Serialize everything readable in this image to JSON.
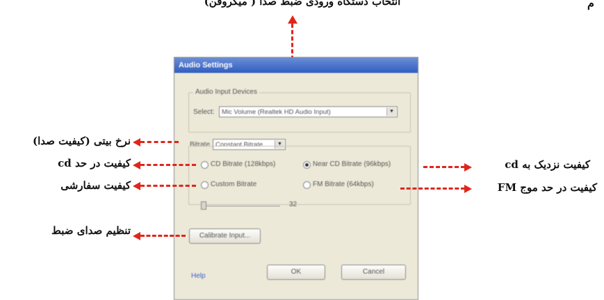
{
  "page": {
    "top_caption": "انتخاب دستگاه ورودی ضبط صدا ( میکروفن)",
    "top_letter": "م"
  },
  "annotations": {
    "bitrate_left": "نرخ بیتی (کیفیت صدا)",
    "cd_quality_left": "کیفیت در حد cd",
    "custom_quality_left": "کیفیت سفارشی",
    "calibrate_left": "تنظیم صدای ضبط",
    "near_cd_right": "کیفیت نزدیک به cd",
    "fm_right": "کیفیت در حد موج FM"
  },
  "dialog": {
    "title": "Audio Settings",
    "input_group_legend": "Audio Input Devices",
    "select_label": "Select:",
    "device_value": "Mic Volume (Realtek HD Audio Input)",
    "bitrate_label": "Bitrate",
    "bitrate_mode": "Constant Bitrate",
    "radio_cd": "CD Bitrate (128kbps)",
    "radio_near_cd": "Near CD Bitrate (96kbps)",
    "radio_custom": "Custom Bitrate",
    "radio_fm": "FM Bitrate (64kbps)",
    "slider_value": "32",
    "calibrate_button": "Calibrate Input...",
    "help_link": "Help",
    "ok_button": "OK",
    "cancel_button": "Cancel"
  },
  "colors": {
    "arrow": "#e0261b",
    "titlebar": "#2f5cc0"
  }
}
